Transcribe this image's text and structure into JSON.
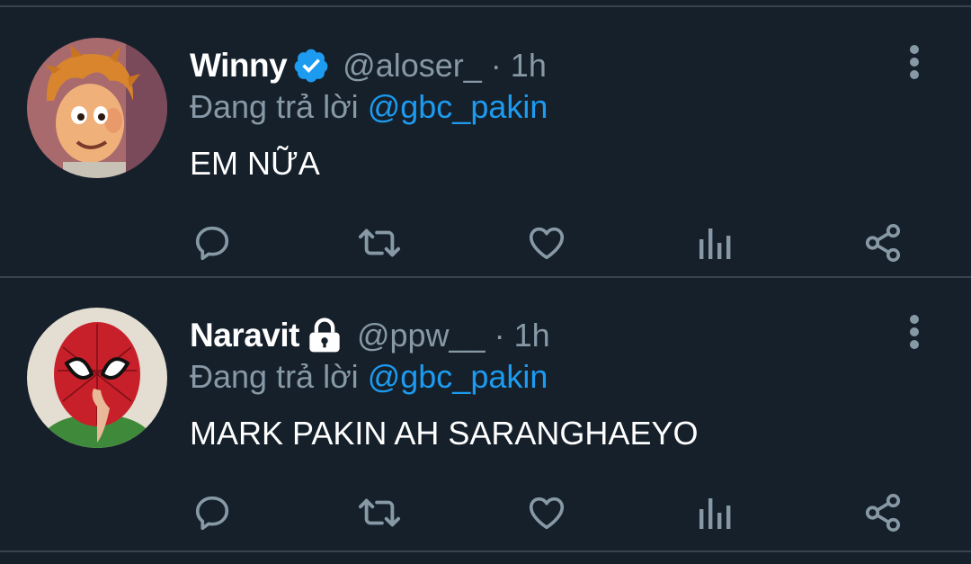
{
  "tweets": [
    {
      "name": "Winny",
      "handle": "@aloser_",
      "separator": "·",
      "time": "1h",
      "reply_prefix": "Đang trả lời",
      "reply_to": "@gbc_pakin",
      "text": "EM NỮA",
      "badge": "verified-icon",
      "avatar": "cartoon-boy-avatar"
    },
    {
      "name": "Naravit",
      "handle": "@ppw__",
      "separator": "·",
      "time": "1h",
      "reply_prefix": "Đang trả lời",
      "reply_to": "@gbc_pakin",
      "text": "MARK PAKIN AH SARANGHAEYO",
      "badge": "lock-icon",
      "avatar": "spiderman-mask-avatar"
    }
  ],
  "actions": [
    "reply-icon",
    "retweet-icon",
    "like-icon",
    "analytics-icon",
    "share-icon"
  ],
  "colors": {
    "background": "#15202b",
    "divider": "#38444d",
    "muted": "#8899a6",
    "link": "#1d9bf0",
    "text": "#ffffff"
  }
}
